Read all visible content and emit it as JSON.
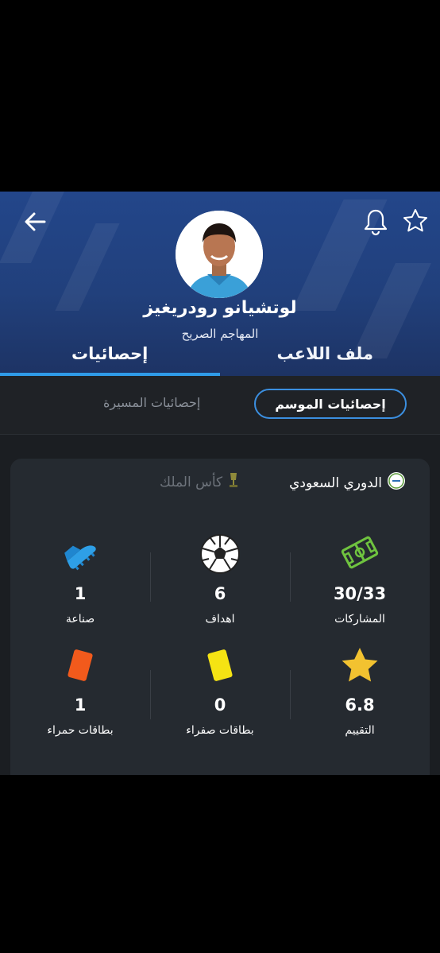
{
  "player": {
    "name": "لوتشيانو رودريغيز",
    "position": "المهاجم الصريح"
  },
  "tabs": {
    "stats": "إحصائيات",
    "profile": "ملف اللاعب"
  },
  "segments": {
    "season": "إحصائيات الموسم",
    "career": "إحصائيات المسيرة"
  },
  "competitions": {
    "active": "الدوري السعودي",
    "inactive": "كأس الملك"
  },
  "stats": {
    "appearances": {
      "value": "30/33",
      "label": "المشاركات",
      "icon": "pitch-icon"
    },
    "goals": {
      "value": "6",
      "label": "اهداف",
      "icon": "football-icon"
    },
    "assists": {
      "value": "1",
      "label": "صناعة",
      "icon": "boot-icon"
    },
    "rating": {
      "value": "6.8",
      "label": "التقييم",
      "icon": "star-icon"
    },
    "yellow": {
      "value": "0",
      "label": "بطاقات صفراء",
      "icon": "yellow-card-icon"
    },
    "red": {
      "value": "1",
      "label": "بطاقات حمراء",
      "icon": "red-card-icon"
    }
  },
  "colors": {
    "header": "#23468a",
    "accent": "#2f9be8",
    "card": "#252a30"
  }
}
